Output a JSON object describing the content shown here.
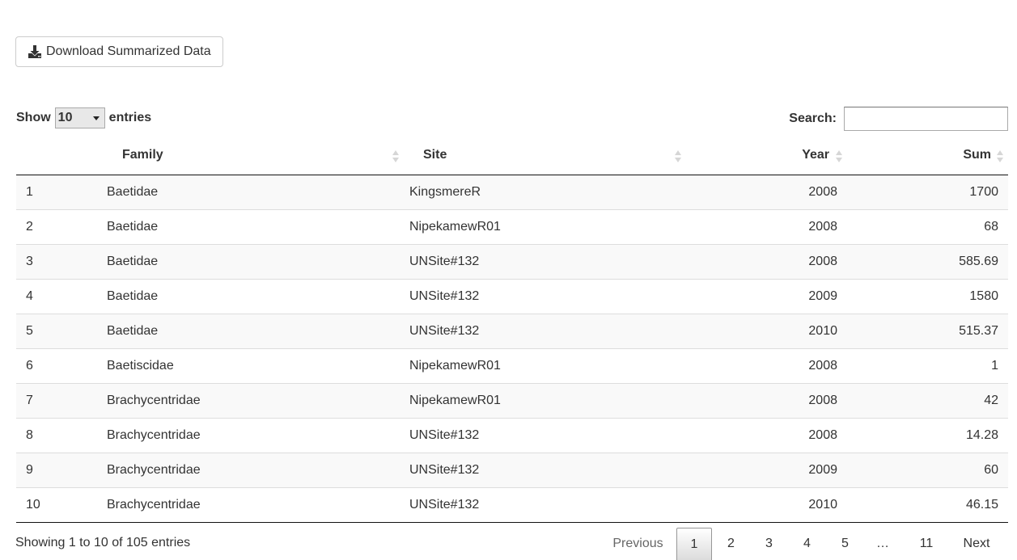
{
  "download_button": {
    "label": "Download Summarized Data",
    "icon": "download-icon"
  },
  "length_menu": {
    "prefix": "Show",
    "selected": "10",
    "suffix": "entries"
  },
  "search": {
    "label": "Search:",
    "value": "",
    "placeholder": ""
  },
  "table": {
    "columns": [
      "",
      "Family",
      "Site",
      "Year",
      "Sum"
    ],
    "rows": [
      [
        "1",
        "Baetidae",
        "KingsmereR",
        "2008",
        "1700"
      ],
      [
        "2",
        "Baetidae",
        "NipekamewR01",
        "2008",
        "68"
      ],
      [
        "3",
        "Baetidae",
        "UNSite#132",
        "2008",
        "585.69"
      ],
      [
        "4",
        "Baetidae",
        "UNSite#132",
        "2009",
        "1580"
      ],
      [
        "5",
        "Baetidae",
        "UNSite#132",
        "2010",
        "515.37"
      ],
      [
        "6",
        "Baetiscidae",
        "NipekamewR01",
        "2008",
        "1"
      ],
      [
        "7",
        "Brachycentridae",
        "NipekamewR01",
        "2008",
        "42"
      ],
      [
        "8",
        "Brachycentridae",
        "UNSite#132",
        "2008",
        "14.28"
      ],
      [
        "9",
        "Brachycentridae",
        "UNSite#132",
        "2009",
        "60"
      ],
      [
        "10",
        "Brachycentridae",
        "UNSite#132",
        "2010",
        "46.15"
      ]
    ]
  },
  "info": "Showing 1 to 10 of 105 entries",
  "pagination": {
    "previous": "Previous",
    "pages": [
      "1",
      "2",
      "3",
      "4",
      "5",
      "…",
      "11"
    ],
    "current": "1",
    "next": "Next"
  },
  "colors": {
    "header_border": "#111111",
    "row_stripe": "#f9f9f9",
    "row_border": "#dddddd"
  }
}
